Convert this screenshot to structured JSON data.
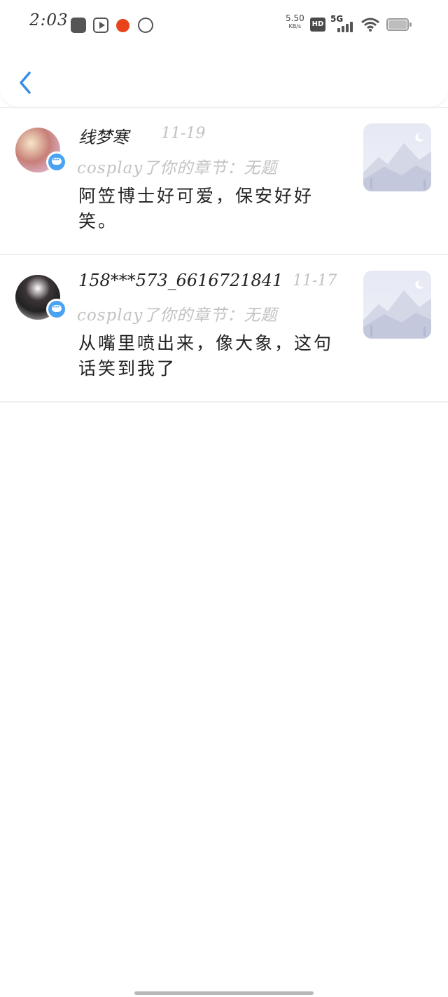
{
  "status_bar": {
    "time": "2:03",
    "net_speed": "5.50",
    "net_unit": "KB/s",
    "hd_label": "HD",
    "network": "5G"
  },
  "comments": [
    {
      "user": "线梦寒",
      "date": "11-19",
      "reference": "cosplay了你的章节：无题",
      "content": "阿笠博士好可爱，保安好好笑。"
    },
    {
      "user": "158***573_6616721841",
      "date": "11-17",
      "reference": "cosplay了你的章节：无题",
      "content": "从嘴里喷出来，像大象，这句话笑到我了"
    }
  ],
  "colors": {
    "accent": "#3a8ee6",
    "badge": "#4aa3f2",
    "muted_text": "#c2c2c2"
  }
}
